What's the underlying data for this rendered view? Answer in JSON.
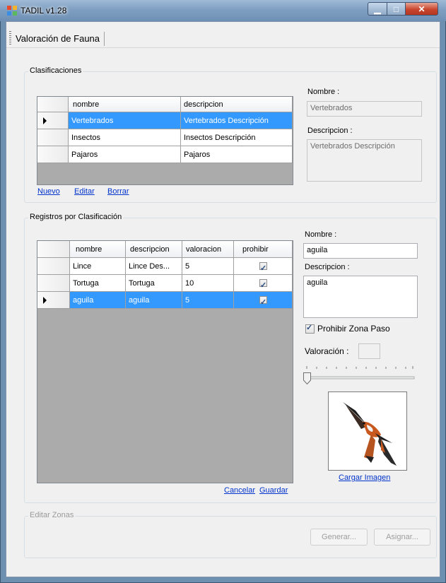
{
  "window": {
    "title": "TADIL v1.28",
    "minimize": "▁",
    "maximize": "□",
    "close": "✕"
  },
  "tabs": [
    {
      "label": "Valoración de Fauna"
    }
  ],
  "clasificaciones": {
    "title": "Clasificaciones",
    "columns": [
      "nombre",
      "descripcion"
    ],
    "rows": [
      {
        "nombre": "Vertebrados",
        "descripcion": "Vertebrados Descripción",
        "selected": true
      },
      {
        "nombre": "Insectos",
        "descripcion": "Insectos Descripción",
        "selected": false
      },
      {
        "nombre": "Pajaros",
        "descripcion": "Pajaros",
        "selected": false
      }
    ],
    "links": {
      "nuevo": "Nuevo",
      "editar": "Editar",
      "borrar": "Borrar"
    },
    "detail": {
      "nombre_label": "Nombre :",
      "nombre_value": "Vertebrados",
      "descripcion_label": "Descripcion :",
      "descripcion_value": "Vertebrados Descripción"
    }
  },
  "registros": {
    "title": "Registros por Clasificación",
    "columns": [
      "nombre",
      "descripcion",
      "valoracion",
      "prohibir"
    ],
    "rows": [
      {
        "nombre": "Lince",
        "descripcion": "Lince Des...",
        "valoracion": "5",
        "prohibir": true,
        "selected": false
      },
      {
        "nombre": "Tortuga",
        "descripcion": "Tortuga",
        "valoracion": "10",
        "prohibir": true,
        "selected": false
      },
      {
        "nombre": "aguila",
        "descripcion": "aguila",
        "valoracion": "5",
        "prohibir": true,
        "selected": true
      }
    ],
    "links": {
      "cancelar": "Cancelar",
      "guardar": "Guardar"
    },
    "detail": {
      "nombre_label": "Nombre :",
      "nombre_value": "aguila",
      "descripcion_label": "Descripcion :",
      "descripcion_value": "aguila",
      "prohibir_label": "Prohibir Zona Paso",
      "prohibir_checked": true,
      "valoracion_label": "Valoración :",
      "valoracion_value": "",
      "slider_level": 0,
      "cargar_imagen": "Cargar Imagen",
      "image_icon": "eagle-photo"
    }
  },
  "zonas": {
    "title": "Editar Zonas",
    "generar": "Generar...",
    "asignar": "Asignar..."
  },
  "colors": {
    "selection": "#3399ff",
    "link": "#0033cc",
    "grid_bg": "#ababab"
  }
}
